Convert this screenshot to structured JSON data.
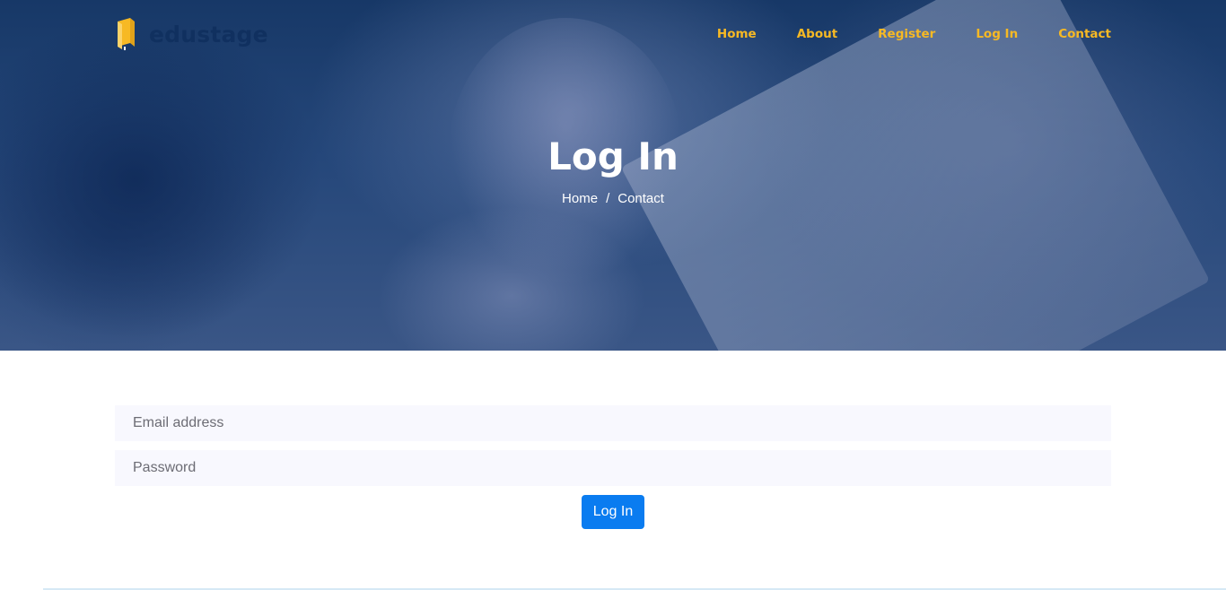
{
  "brand": {
    "name": "edustage",
    "logo_icon": "book-icon",
    "logo_color": "#f7b924"
  },
  "nav": {
    "items": [
      {
        "label": "Home"
      },
      {
        "label": "About"
      },
      {
        "label": "Register"
      },
      {
        "label": "Log In"
      },
      {
        "label": "Contact"
      }
    ],
    "link_color": "#f7b924"
  },
  "hero": {
    "title": "Log In",
    "breadcrumb": {
      "home": "Home",
      "separator": "/",
      "current": "Contact"
    }
  },
  "login_form": {
    "email": {
      "value": "",
      "placeholder": "Email address"
    },
    "password": {
      "value": "",
      "placeholder": "Password"
    },
    "submit_label": "Log In",
    "submit_color": "#0a7cf0"
  }
}
